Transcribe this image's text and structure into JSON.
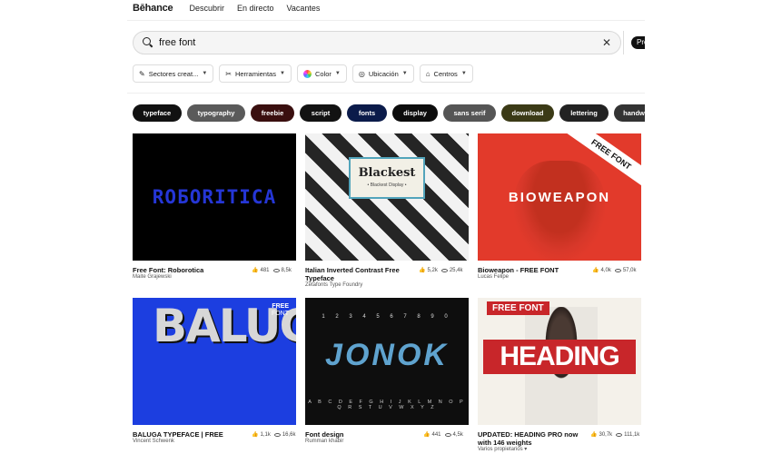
{
  "nav": {
    "logo": "Bēhance",
    "links": [
      "Descubrir",
      "En directo",
      "Vacantes"
    ]
  },
  "search": {
    "value": "free font",
    "clear_icon": "close-icon",
    "submit_label": "Pro"
  },
  "filters": [
    {
      "label": "Sectores creat...",
      "icon": "brush-icon"
    },
    {
      "label": "Herramientas",
      "icon": "tools-icon"
    },
    {
      "label": "Color",
      "icon": "color-wheel-icon"
    },
    {
      "label": "Ubicación",
      "icon": "location-icon"
    },
    {
      "label": "Centros",
      "icon": "school-icon"
    }
  ],
  "tags": [
    {
      "label": "typeface",
      "color": "#111111"
    },
    {
      "label": "typography",
      "color": "#5a5a5a"
    },
    {
      "label": "freebie",
      "color": "#3a0f0f"
    },
    {
      "label": "script",
      "color": "#121212"
    },
    {
      "label": "fonts",
      "color": "#0b1b4a"
    },
    {
      "label": "display",
      "color": "#0c0c0c"
    },
    {
      "label": "sans serif",
      "color": "#555555"
    },
    {
      "label": "download",
      "color": "#3b3a16"
    },
    {
      "label": "lettering",
      "color": "#222222"
    },
    {
      "label": "handw",
      "color": "#333333"
    }
  ],
  "projects": [
    {
      "title": "Free Font: Roborotica",
      "owner": "Maite Grajewski",
      "likes": "481",
      "views": "8,5k",
      "art": "RОБОRITICA"
    },
    {
      "title": "Italian Inverted Contrast Free Typeface",
      "owner": "Zetafonts Type Foundry",
      "likes": "5,2k",
      "views": "25,4k",
      "art": "Blackest",
      "art_sub": "• Blackest Display •"
    },
    {
      "title": "Bioweapon - FREE FONT",
      "owner": "Lucas Felipe",
      "likes": "4,0k",
      "views": "57,0k",
      "art": "BIOWEAPON",
      "art_ribbon": "FREE FONT"
    },
    {
      "title": "BALUGA TYPEFACE | FREE",
      "owner": "Vincent Schwenk",
      "likes": "1,1k",
      "views": "16,6k",
      "art": "BALUGA",
      "art_free": "FREE",
      "art_font": "FONT"
    },
    {
      "title": "Font design",
      "owner": "Rumman khabir",
      "likes": "441",
      "views": "4,5k",
      "art": "JONOK",
      "art_nums": "1 2 3 4 5 6 7 8 9 0",
      "art_alpha": "A B C D E F G H I J K L M N O P Q R S T U V W X Y Z"
    },
    {
      "title": "UPDATED: HEADING PRO now with 146 weights",
      "owner": "Varios propietarios",
      "likes": "30,7k",
      "views": "111,1k",
      "art": "HEADING",
      "art_tag": "FREE FONT"
    }
  ]
}
